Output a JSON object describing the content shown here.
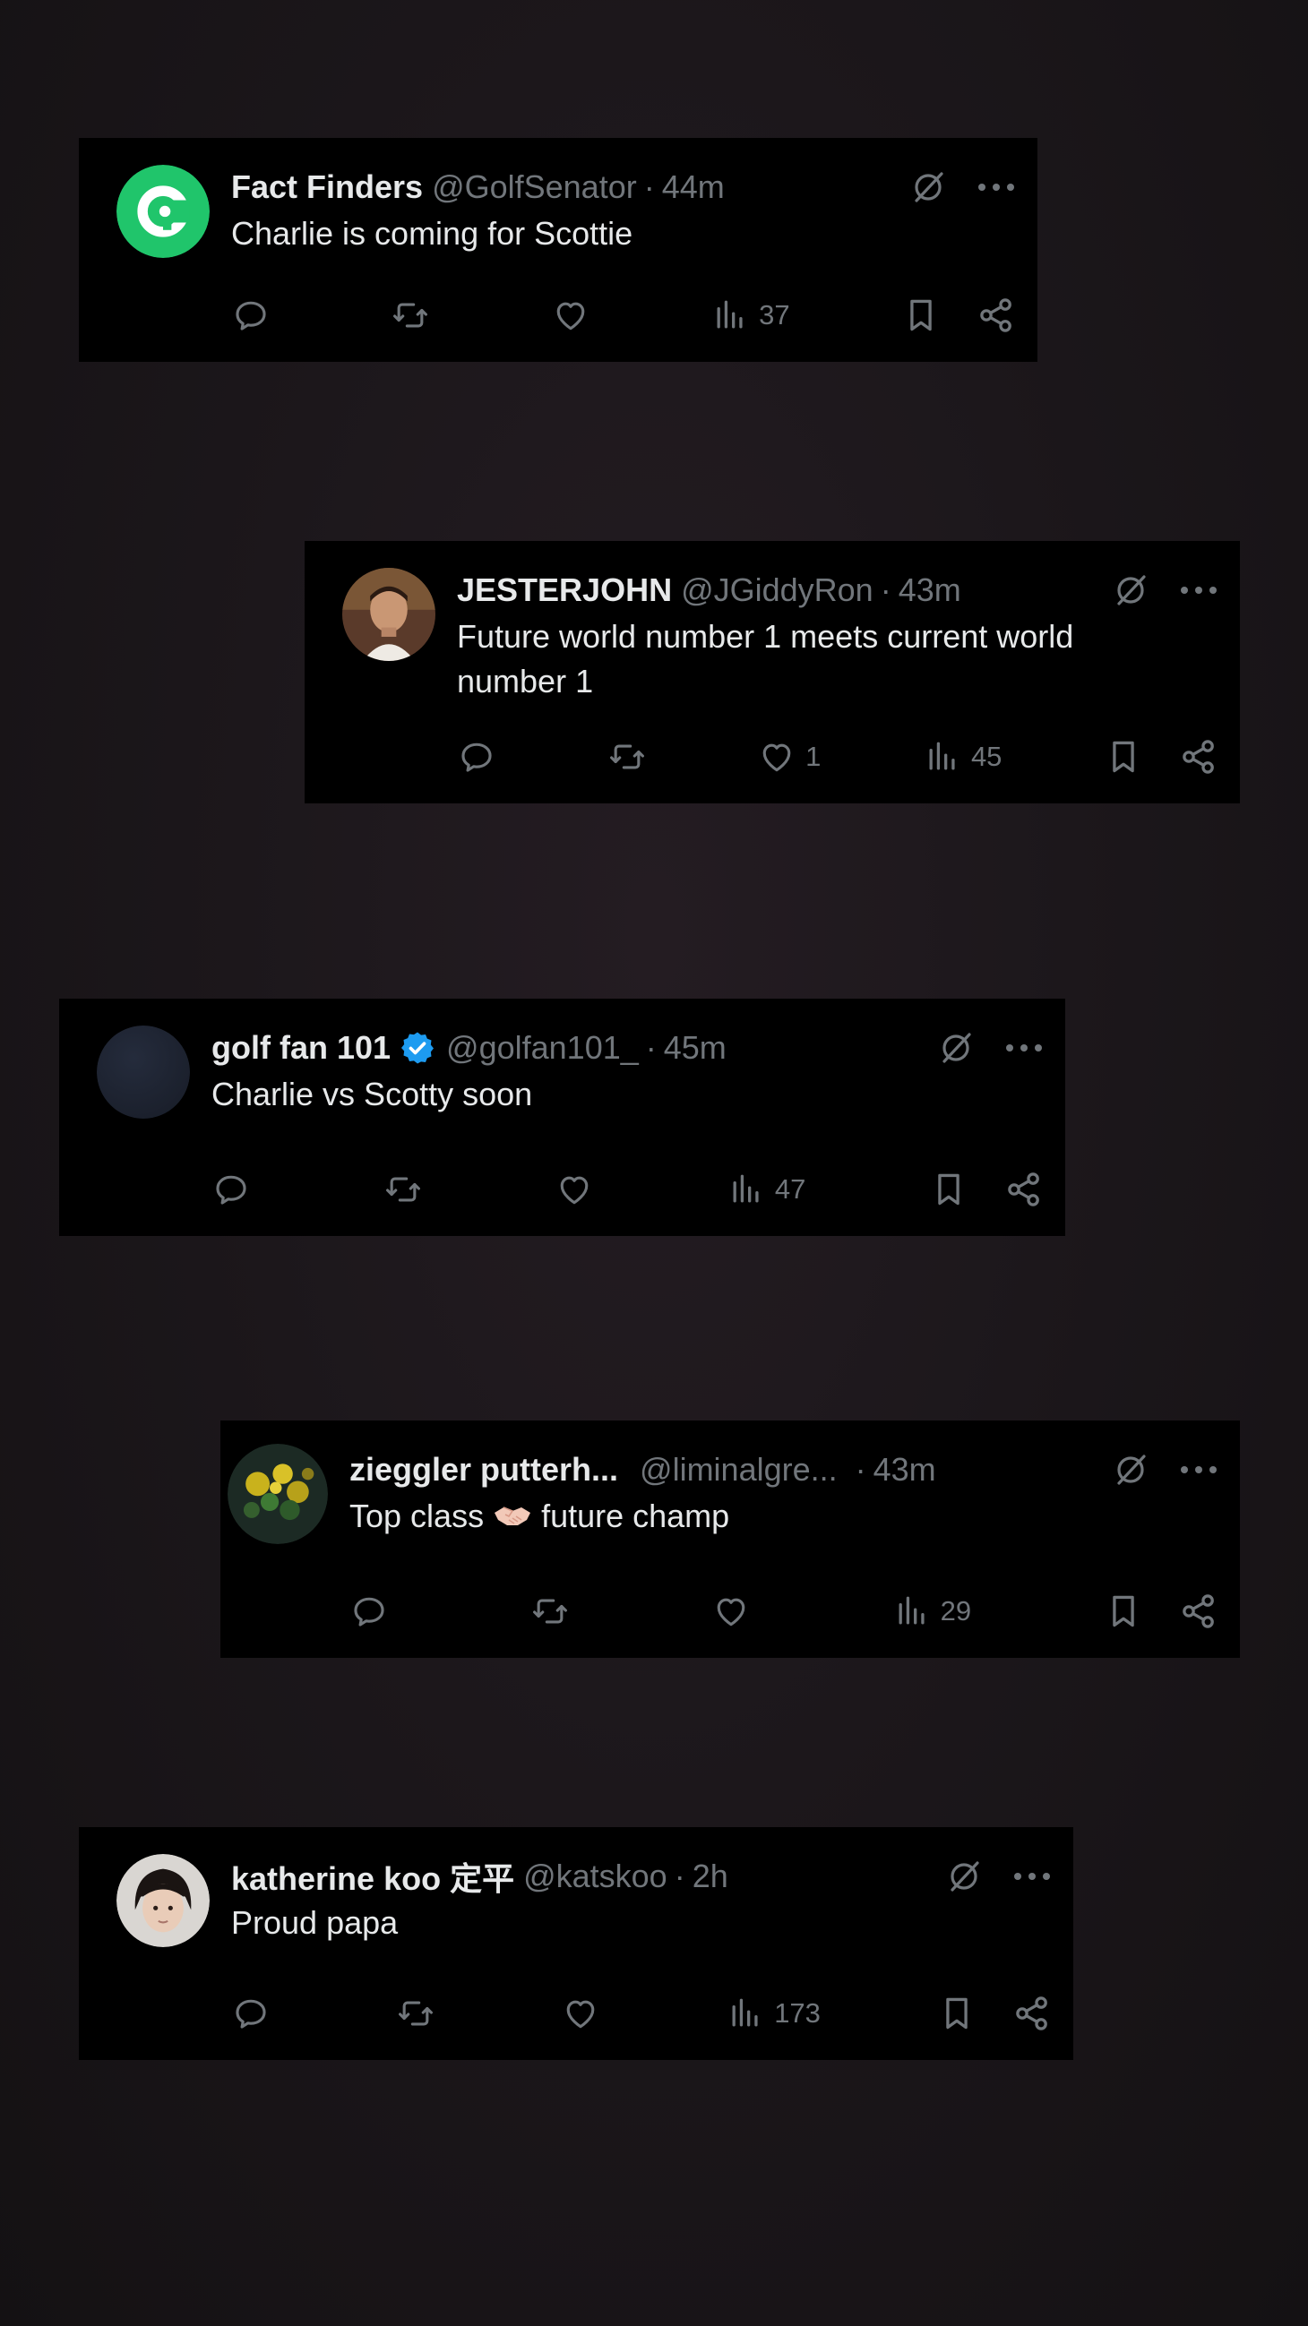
{
  "tweets": [
    {
      "name": "Fact Finders",
      "verified": false,
      "handle": "@GolfSenator",
      "separator": "·",
      "time": "44m",
      "text": "Charlie is coming for Scottie",
      "replies": "",
      "reposts": "",
      "likes": "",
      "views": "37",
      "avatar": "green-logo-avatar"
    },
    {
      "name": "JESTERJOHN",
      "verified": false,
      "handle": "@JGiddyRon",
      "separator": "·",
      "time": "43m",
      "text": "Future world number 1 meets current world number 1",
      "replies": "",
      "reposts": "",
      "likes": "1",
      "views": "45",
      "avatar": "man-photo-avatar"
    },
    {
      "name": "golf fan 101",
      "verified": true,
      "handle": "@golfan101_",
      "separator": "·",
      "time": "45m",
      "text": "Charlie vs Scotty soon",
      "replies": "",
      "reposts": "",
      "likes": "",
      "views": "47",
      "avatar": "dark-blue-avatar"
    },
    {
      "name": "zieggler putterh...",
      "verified": false,
      "handle": "@liminalgre...",
      "separator": "·",
      "time": "43m",
      "text_before": "Top class",
      "text_emoji": "handshake-emoji",
      "text_after": "future champ",
      "replies": "",
      "reposts": "",
      "likes": "",
      "views": "29",
      "avatar": "flowers-photo-avatar"
    },
    {
      "name": "katherine koo 定平",
      "verified": false,
      "handle": "@katskoo",
      "separator": "·",
      "time": "2h",
      "text": "Proud papa",
      "replies": "",
      "reposts": "",
      "likes": "",
      "views": "173",
      "avatar": "child-photo-avatar"
    }
  ],
  "colors": {
    "card": "#000000",
    "text": "#e7e9ea",
    "muted": "#71767b",
    "verified": "#1d9bf0",
    "brand_green": "#20c56b"
  },
  "icons": [
    "grok-icon",
    "more-icon",
    "reply-icon",
    "repost-icon",
    "like-icon",
    "views-icon",
    "bookmark-icon",
    "share-icon"
  ]
}
